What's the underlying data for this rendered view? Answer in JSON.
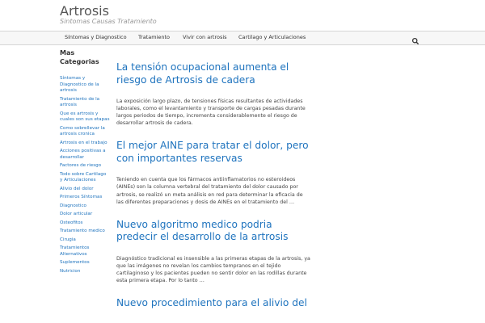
{
  "site": {
    "title": "Artrosis",
    "description": "Sintomas Causas Tratamiento"
  },
  "nav": {
    "items": [
      {
        "label": "Síntomas y Diagnostico"
      },
      {
        "label": "Tratamiento"
      },
      {
        "label": "Vivir con artrosis"
      },
      {
        "label": "Cartilago y Articulaciones"
      }
    ],
    "search_icon": "search-icon"
  },
  "sidebar": {
    "title": "Mas Categorias",
    "categories": [
      "Síntomas y Diagnostico de la artrosis",
      "Tratamiento de la artrosis",
      "Que es artrosis y cuales son sus etapas",
      "Como sobrellevar la artrosis cronica",
      "Artrosis en el trabajo",
      "Acciones positivas a desarrollar",
      "Factores de riesgo",
      "Todo sobre Cartilago y Articulaciones",
      "Alivio del dolor",
      "Primeros Síntomas",
      "Diagnostico",
      "Dolor articular",
      "Osteofitos",
      "Tratamiento medico",
      "Cirugia",
      "Tratamientos Alternativos",
      "Suplementos",
      "Nutricion"
    ]
  },
  "posts": [
    {
      "title": "La tensión ocupacional aumenta el riesgo de Artrosis de cadera",
      "excerpt": "La exposición largo plazo, de tensiones físicas resultantes de actividades laborales, como el levantamiento y transporte de cargas pesadas durante largos periodos de tiempo, incrementa considerablemente el riesgo de desarrollar artrosis de cadera."
    },
    {
      "title": "El mejor AINE para tratar el dolor, pero con importantes reservas",
      "excerpt": "Teniendo en cuenta que los fármacos antiinflamatorios no esteroideos (AINEs) son la columna vertebral del tratamiento del dolor causado por artrosis, se realizó un meta análisis en red para determinar la eficacia de las diferentes preparaciones y dosis de AINEs en el tratamiento del …"
    },
    {
      "title": "Nuevo algoritmo medico podria predecir el desarrollo de la artrosis",
      "excerpt": "Diagnóstico tradicional es insensible a las primeras etapas de la artrosis, ya que las imágenes no revelan los cambios tempranos en el tejido cartilaginoso y los pacientes pueden no sentir dolor en las rodillas durante esta primera etapa. Por lo tanto …"
    },
    {
      "title": "Nuevo procedimiento para el alivio del",
      "excerpt": ""
    }
  ],
  "colors": {
    "link": "#1e73be",
    "nav_background": "#f7f7f7",
    "border": "#d6d6d6"
  }
}
